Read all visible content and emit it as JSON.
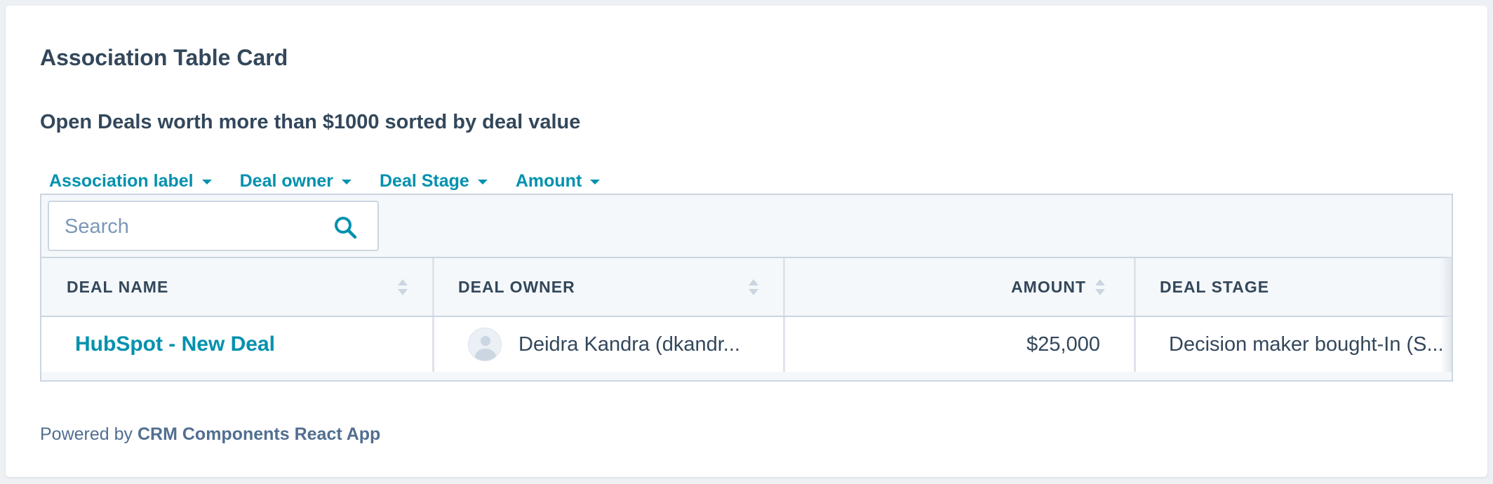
{
  "card": {
    "title": "Association Table Card",
    "subtitle": "Open Deals worth more than $1000 sorted by deal value"
  },
  "filters": [
    {
      "label": "Association label",
      "icon": "caret-down-icon"
    },
    {
      "label": "Deal owner",
      "icon": "caret-down-icon"
    },
    {
      "label": "Deal Stage",
      "icon": "caret-down-icon"
    },
    {
      "label": "Amount",
      "icon": "caret-down-icon"
    }
  ],
  "search": {
    "placeholder": "Search",
    "value": "",
    "icon": "search-icon"
  },
  "table": {
    "columns": [
      {
        "label": "DEAL NAME",
        "sortable": true
      },
      {
        "label": "DEAL OWNER",
        "sortable": true
      },
      {
        "label": "AMOUNT",
        "sortable": true
      },
      {
        "label": "DEAL STAGE",
        "sortable": false
      }
    ],
    "rows": [
      {
        "deal_name": "HubSpot - New Deal",
        "deal_owner": "Deidra Kandra (dkandr...",
        "amount": "$25,000",
        "deal_stage": "Decision maker bought-In (S..."
      }
    ]
  },
  "footer": {
    "prefix": "Powered by",
    "app_name": "CRM Components React App"
  },
  "colors": {
    "link": "#0091ae",
    "text": "#33475b",
    "border": "#cbd6e2",
    "header_bg": "#f5f8fa"
  }
}
